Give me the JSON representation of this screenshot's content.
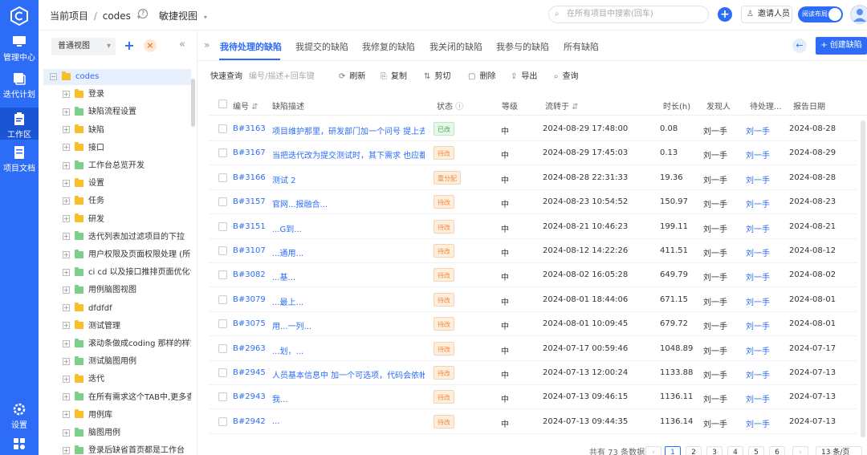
{
  "rail": {
    "items": [
      {
        "label": "管理中心",
        "icon": "monitor-icon"
      },
      {
        "label": "迭代计划",
        "icon": "layers-icon"
      },
      {
        "label": "工作区",
        "icon": "clipboard-icon"
      },
      {
        "label": "项目文档",
        "icon": "document-icon"
      },
      {
        "label": "设置",
        "icon": "gear-icon"
      }
    ]
  },
  "header": {
    "project_label": "当前项目",
    "separator": "/",
    "project_name": "codes",
    "view_name": "敏捷视图",
    "search_placeholder": "在所有项目中搜索(回车)",
    "invite_label": "邀请人员",
    "layout_toggle": "阅读布局"
  },
  "tree": {
    "view_select": "普通视图",
    "items": [
      {
        "label": "codes",
        "color": "yellow",
        "level": 0,
        "expand": "−"
      },
      {
        "label": "登录",
        "color": "yellow",
        "level": 1,
        "expand": "+"
      },
      {
        "label": "缺陷流程设置",
        "color": "green",
        "level": 1,
        "expand": "+"
      },
      {
        "label": "缺陷",
        "color": "yellow",
        "level": 1,
        "expand": "+"
      },
      {
        "label": "接口",
        "color": "yellow",
        "level": 1,
        "expand": "+"
      },
      {
        "label": "工作台总览开发",
        "color": "green",
        "level": 1,
        "expand": "+"
      },
      {
        "label": "设置",
        "color": "yellow",
        "level": 1,
        "expand": "+"
      },
      {
        "label": "任务",
        "color": "yellow",
        "level": 1,
        "expand": "+"
      },
      {
        "label": "研发",
        "color": "yellow",
        "level": 1,
        "expand": "+"
      },
      {
        "label": "迭代列表加过滤项目的下拉",
        "color": "green",
        "level": 1,
        "expand": "+"
      },
      {
        "label": "用户权限及页面权限处理 (所有",
        "color": "green",
        "level": 1,
        "expand": "+"
      },
      {
        "label": "ci cd 以及接口推排页面优化设",
        "color": "green",
        "level": 1,
        "expand": "+"
      },
      {
        "label": "用例脑图视图",
        "color": "green",
        "level": 1,
        "expand": "+"
      },
      {
        "label": "dfdfdf",
        "color": "yellow",
        "level": 1,
        "expand": "+"
      },
      {
        "label": "测试管理",
        "color": "yellow",
        "level": 1,
        "expand": "+"
      },
      {
        "label": "滚动条做成coding 那样的样式",
        "color": "green",
        "level": 1,
        "expand": "+"
      },
      {
        "label": "测试脑图用例",
        "color": "green",
        "level": 1,
        "expand": "+"
      },
      {
        "label": "迭代",
        "color": "yellow",
        "level": 1,
        "expand": "+"
      },
      {
        "label": "在所有需求这个TAB中,更多查设",
        "color": "green",
        "level": 1,
        "expand": "+"
      },
      {
        "label": "用例库",
        "color": "yellow",
        "level": 1,
        "expand": "+"
      },
      {
        "label": "脑图用例",
        "color": "green",
        "level": 1,
        "expand": "+"
      },
      {
        "label": "登录后缺省首页都是工作台",
        "color": "green",
        "level": 1,
        "expand": "+"
      }
    ]
  },
  "tabs": [
    "我待处理的缺陷",
    "我提交的缺陷",
    "我修复的缺陷",
    "我关闭的缺陷",
    "我参与的缺陷",
    "所有缺陷"
  ],
  "create_button": "+ 创建缺陷",
  "toolbar": {
    "quick_query": "快速查询",
    "quick_placeholder": "编号/描述+回车键",
    "actions": [
      {
        "label": "刷新",
        "icon": "refresh-icon",
        "glyph": "⟳"
      },
      {
        "label": "复制",
        "icon": "copy-icon",
        "glyph": "⎘"
      },
      {
        "label": "剪切",
        "icon": "scissors-icon",
        "glyph": "⇅"
      },
      {
        "label": "删除",
        "icon": "trash-icon",
        "glyph": "▢"
      },
      {
        "label": "导出",
        "icon": "export-icon",
        "glyph": "⇪"
      },
      {
        "label": "查询",
        "icon": "search-icon",
        "glyph": "⌕"
      }
    ]
  },
  "table": {
    "headers": [
      "编号",
      "缺陷描述",
      "状态",
      "等级",
      "流转于",
      "时长(h)",
      "发现人",
      "待处理...",
      "报告日期"
    ],
    "rows": [
      {
        "id": "B#3163",
        "desc": "项目维护那里，研发部门加一个问号 提上去...",
        "status": "已改",
        "status_type": "done",
        "level": "中",
        "flow": "2024-08-29 17:48:00",
        "hours": "0.08",
        "finder": "刘一手",
        "assignee": "刘一手",
        "date": "2024-08-28"
      },
      {
        "id": "B#3167",
        "desc": "当把迭代改为提交测试时，其下需求 也应都...",
        "status": "待改",
        "status_type": "todo",
        "level": "中",
        "flow": "2024-08-29 17:45:03",
        "hours": "0.13",
        "finder": "刘一手",
        "assignee": "刘一手",
        "date": "2024-08-29"
      },
      {
        "id": "B#3166",
        "desc": "测试 2",
        "status": "重分配",
        "status_type": "re",
        "level": "中",
        "flow": "2024-08-28 22:31:33",
        "hours": "19.36",
        "finder": "刘一手",
        "assignee": "刘一手",
        "date": "2024-08-28"
      },
      {
        "id": "B#3157",
        "desc": "官网...报融合...",
        "status": "待改",
        "status_type": "todo",
        "level": "中",
        "flow": "2024-08-23 10:54:52",
        "hours": "150.97",
        "finder": "刘一手",
        "assignee": "刘一手",
        "date": "2024-08-23"
      },
      {
        "id": "B#3151",
        "desc": "...G到...",
        "status": "待改",
        "status_type": "todo",
        "level": "中",
        "flow": "2024-08-21 10:46:23",
        "hours": "199.11",
        "finder": "刘一手",
        "assignee": "刘一手",
        "date": "2024-08-21"
      },
      {
        "id": "B#3107",
        "desc": "...通用...",
        "status": "待改",
        "status_type": "todo",
        "level": "中",
        "flow": "2024-08-12 14:22:26",
        "hours": "411.51",
        "finder": "刘一手",
        "assignee": "刘一手",
        "date": "2024-08-12"
      },
      {
        "id": "B#3082",
        "desc": "...基...",
        "status": "待改",
        "status_type": "todo",
        "level": "中",
        "flow": "2024-08-02 16:05:28",
        "hours": "649.79",
        "finder": "刘一手",
        "assignee": "刘一手",
        "date": "2024-08-02"
      },
      {
        "id": "B#3079",
        "desc": "...最上...",
        "status": "待改",
        "status_type": "todo",
        "level": "中",
        "flow": "2024-08-01 18:44:06",
        "hours": "671.15",
        "finder": "刘一手",
        "assignee": "刘一手",
        "date": "2024-08-01"
      },
      {
        "id": "B#3075",
        "desc": "用...一列...",
        "status": "待改",
        "status_type": "todo",
        "level": "中",
        "flow": "2024-08-01 10:09:45",
        "hours": "679.72",
        "finder": "刘一手",
        "assignee": "刘一手",
        "date": "2024-08-01"
      },
      {
        "id": "B#2963",
        "desc": "...划，...",
        "status": "待改",
        "status_type": "todo",
        "level": "中",
        "flow": "2024-07-17 00:59:46",
        "hours": "1048.89",
        "finder": "刘一手",
        "assignee": "刘一手",
        "date": "2024-07-17"
      },
      {
        "id": "B#2945",
        "desc": "人员基本信息中 加一个可选项，代码会依帐...",
        "status": "待改",
        "status_type": "todo",
        "level": "中",
        "flow": "2024-07-13 12:00:24",
        "hours": "1133.88",
        "finder": "刘一手",
        "assignee": "刘一手",
        "date": "2024-07-13"
      },
      {
        "id": "B#2943",
        "desc": "我...",
        "status": "待改",
        "status_type": "todo",
        "level": "中",
        "flow": "2024-07-13 09:46:15",
        "hours": "1136.11",
        "finder": "刘一手",
        "assignee": "刘一手",
        "date": "2024-07-13"
      },
      {
        "id": "B#2942",
        "desc": "...",
        "status": "待改",
        "status_type": "todo",
        "level": "中",
        "flow": "2024-07-13 09:44:35",
        "hours": "1136.14",
        "finder": "刘一手",
        "assignee": "刘一手",
        "date": "2024-07-13"
      }
    ]
  },
  "pagination": {
    "total": "共有 73 条数据",
    "pages": [
      "1",
      "2",
      "3",
      "4",
      "5",
      "6"
    ],
    "current": "1",
    "page_size": "13 条/页"
  }
}
